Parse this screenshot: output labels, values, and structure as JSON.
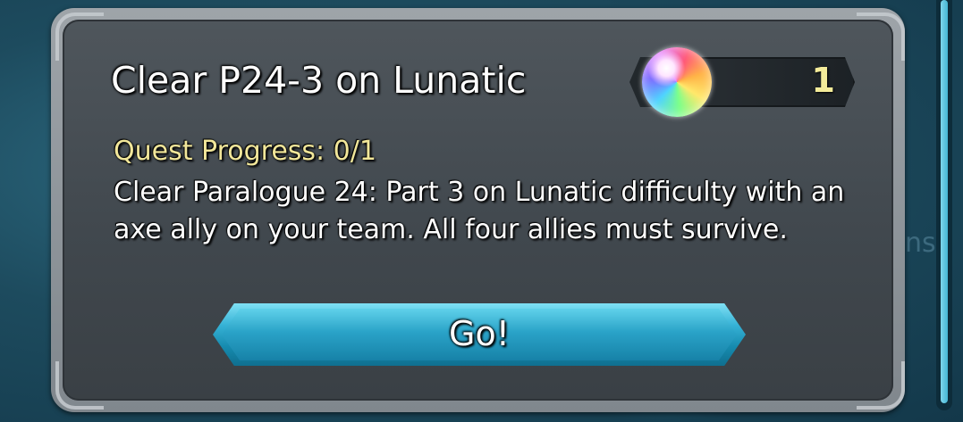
{
  "quest": {
    "title": "Clear P24-3 on Lunatic",
    "progress_text": "Quest Progress: 0/1",
    "description": "Clear Paralogue 24: Part 3 on Lunatic difficulty with an axe ally on your team. All four allies must survive."
  },
  "reward": {
    "icon": "rainbow-orb-icon",
    "count": "1"
  },
  "go_button": {
    "label": "Go!"
  },
  "background": {
    "partial_text": "ns"
  },
  "colors": {
    "panel": "#4a5157",
    "progress_text": "#f2e79a",
    "button": "#2aa3c8",
    "reward_count": "#f4ec9a"
  }
}
